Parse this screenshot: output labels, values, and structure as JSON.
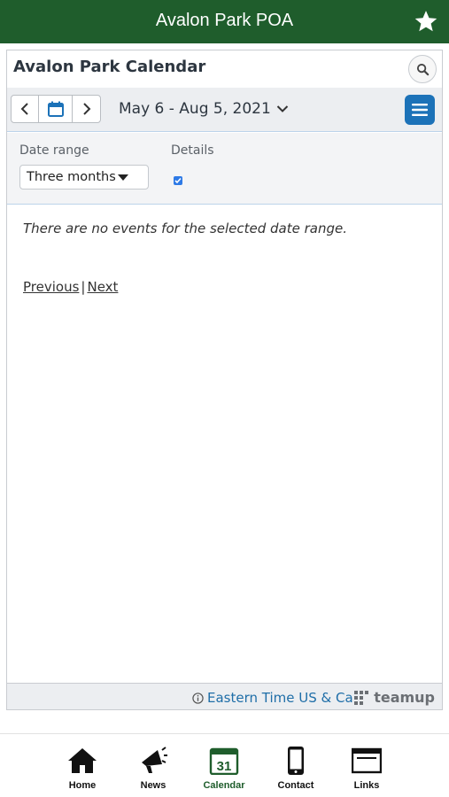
{
  "app": {
    "title": "Avalon Park POA"
  },
  "calendar": {
    "title": "Avalon Park Calendar",
    "date_range_text": "May 6 - Aug 5, 2021",
    "filters": {
      "date_range_label": "Date range",
      "date_range_value": "Three months",
      "details_label": "Details",
      "details_checked": true
    },
    "empty_message": "There are no events for the selected date range.",
    "pager": {
      "previous": "Previous",
      "separator": "|",
      "next": "Next"
    },
    "timezone": "Eastern Time US & Ca",
    "brand": "teamup"
  },
  "tabs": [
    {
      "label": "Home",
      "icon": "home-icon"
    },
    {
      "label": "News",
      "icon": "megaphone-icon"
    },
    {
      "label": "Calendar",
      "icon": "calendar-icon",
      "badge": "31",
      "active": true
    },
    {
      "label": "Contact",
      "icon": "phone-icon"
    },
    {
      "label": "Links",
      "icon": "browser-window-icon"
    }
  ],
  "colors": {
    "header_green": "#1f5d2c",
    "accent_blue": "#1c72b8",
    "link_blue": "#1f6ea8"
  }
}
